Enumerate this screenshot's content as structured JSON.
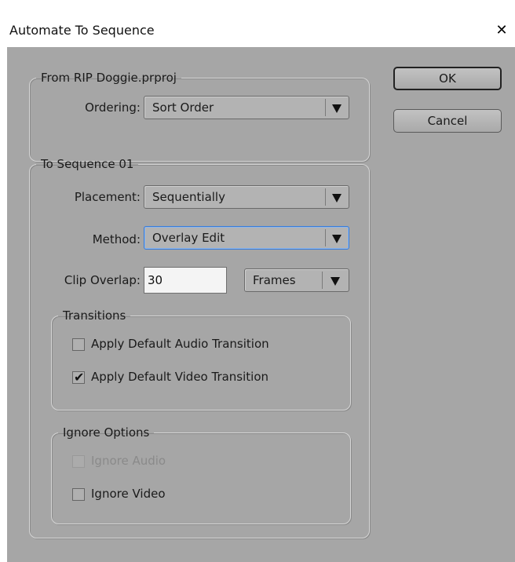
{
  "window": {
    "title": "Automate To Sequence",
    "close_glyph": "✕"
  },
  "from_group": {
    "legend": "From RIP Doggie.prproj",
    "ordering_label": "Ordering:",
    "ordering_value": "Sort Order"
  },
  "to_group": {
    "legend": "To Sequence 01",
    "placement_label": "Placement:",
    "placement_value": "Sequentially",
    "method_label": "Method:",
    "method_value": "Overlay Edit",
    "clip_overlap_label": "Clip Overlap:",
    "clip_overlap_value": "30",
    "clip_overlap_unit": "Frames"
  },
  "transitions": {
    "legend": "Transitions",
    "audio_label": "Apply Default Audio Transition",
    "audio_checked": false,
    "video_label": "Apply Default Video Transition",
    "video_checked": true
  },
  "ignore_options": {
    "legend": "Ignore Options",
    "audio_label": "Ignore Audio",
    "audio_checked": false,
    "audio_disabled": true,
    "video_label": "Ignore Video",
    "video_checked": false
  },
  "buttons": {
    "ok_label": "OK",
    "cancel_label": "Cancel"
  },
  "icons": {
    "dropdown": "triangle-down-icon",
    "check": "checkmark-icon",
    "close": "x-icon"
  },
  "colors": {
    "dialog_bg": "#a6a6a6",
    "focus_border": "#3a7bd5"
  }
}
